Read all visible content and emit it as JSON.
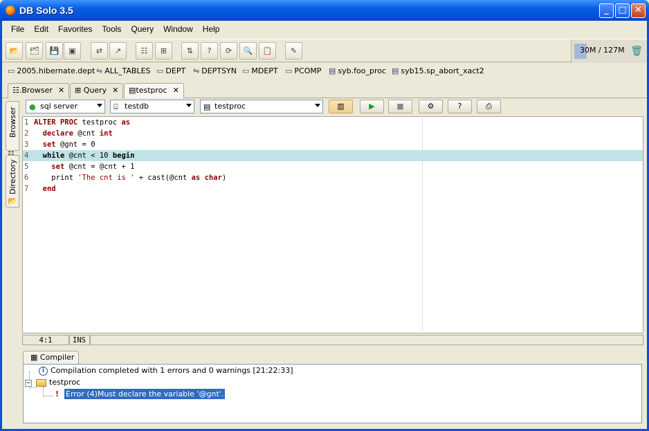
{
  "window": {
    "title": "DB Solo  3.5",
    "buttons": {
      "minimize": "_",
      "maximize": "□",
      "close": "✕"
    }
  },
  "menu": [
    "File",
    "Edit",
    "Favorites",
    "Tools",
    "Query",
    "Window",
    "Help"
  ],
  "toolbar": {
    "icons": [
      "open-folder-icon",
      "open-workspace-icon",
      "save-icon",
      "save-all-icon",
      "connect-icon",
      "disconnect-icon",
      "schema-browser-icon",
      "grid-icon",
      "compare-icon",
      "help-query-icon",
      "refresh-icon",
      "search-icon",
      "clipboard-icon",
      "edit-icon"
    ],
    "memory": "30M / 127M"
  },
  "bookmarks": [
    "2005.hibernate.dept",
    "ALL_TABLES",
    "DEPT",
    "DEPTSYN",
    "MDEPT",
    "PCOMP",
    "syb.foo_proc",
    "syb15.sp_abort_xact2"
  ],
  "tabs": [
    {
      "label": ".Browser",
      "active": false
    },
    {
      "label": "Query",
      "active": false
    },
    {
      "label": "testproc",
      "active": true
    }
  ],
  "side_tabs": [
    "Browser",
    "Directory"
  ],
  "editor_toolbar": {
    "server": "sql server",
    "database": "testdb",
    "object": "testproc"
  },
  "editor": {
    "lines": [
      {
        "n": "1",
        "current": false
      },
      {
        "n": "2",
        "current": false
      },
      {
        "n": "3",
        "current": false
      },
      {
        "n": "4",
        "current": true
      },
      {
        "n": "5",
        "current": false
      },
      {
        "n": "6",
        "current": false
      },
      {
        "n": "7",
        "current": false
      }
    ],
    "code": {
      "l1a": "ALTER PROC",
      "l1b": " testproc ",
      "l1c": "as",
      "l2a": "declare",
      "l2b": " @cnt ",
      "l2c": "int",
      "l3a": "set",
      "l3b": " @gnt = 0",
      "l4a": "while",
      "l4b": " @cnt < 10 ",
      "l4c": "begin",
      "l5a": "set",
      "l5b": " @cnt = @cnt + 1",
      "l6a": "print ",
      "l6b": "'The cnt is '",
      "l6c": " + cast(@cnt ",
      "l6d": "as",
      "l6e": " ",
      "l6f": "char",
      "l6g": ")",
      "l7a": "end"
    }
  },
  "status": {
    "position": "4:1",
    "mode": "INS"
  },
  "compiler": {
    "tab": "Compiler",
    "summary": "Compilation completed with 1 errors and 0 warnings [21:22:33]",
    "node": "testproc",
    "error": "Error (4)Must declare the variable '@gnt'."
  }
}
